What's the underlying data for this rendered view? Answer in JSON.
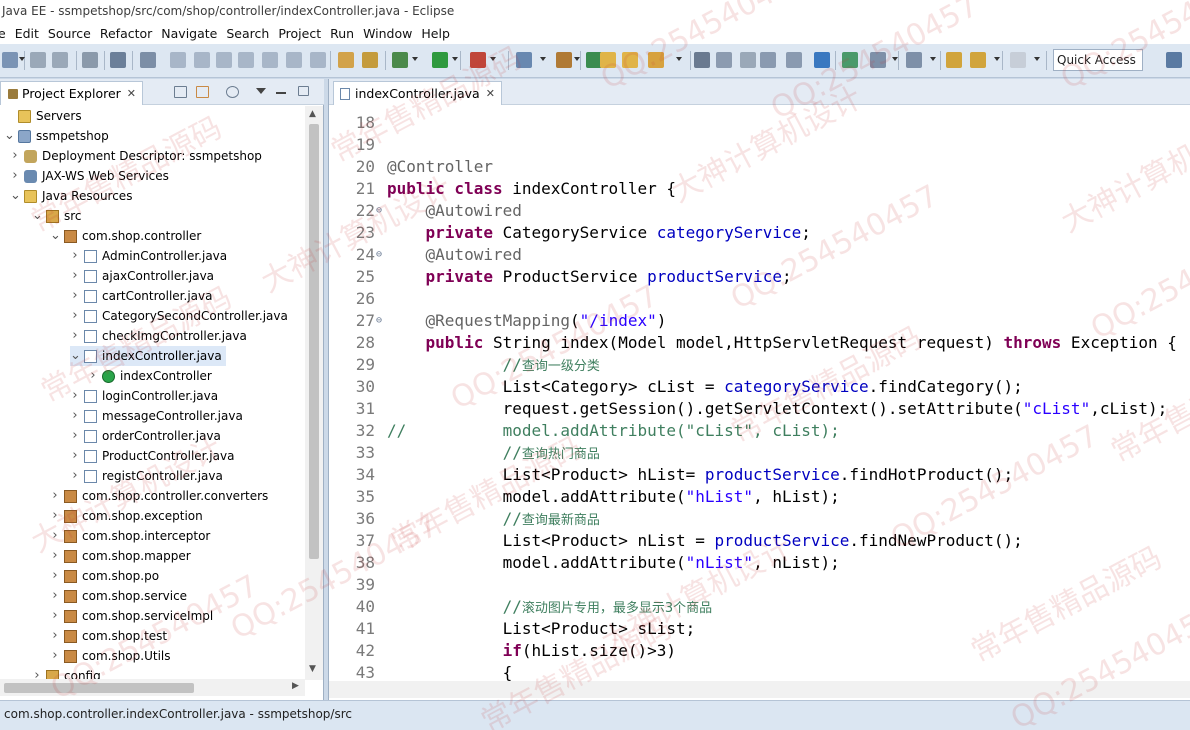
{
  "window": {
    "title": "Java EE - ssmpetshop/src/com/shop/controller/indexController.java - Eclipse"
  },
  "menu": [
    "e",
    "Edit",
    "Source",
    "Refactor",
    "Navigate",
    "Search",
    "Project",
    "Run",
    "Window",
    "Help"
  ],
  "toolbar": {
    "quick_access": "Quick Access"
  },
  "project_explorer": {
    "tab_label": "Project Explorer",
    "tree": [
      {
        "label": "Servers",
        "icon": "folder-icon",
        "arrow": "",
        "indent": 0
      },
      {
        "label": "ssmpetshop",
        "icon": "project-icon",
        "arrow": "open",
        "indent": 0
      },
      {
        "label": "Deployment Descriptor: ssmpetshop",
        "icon": "descriptor-icon",
        "arrow": "closed",
        "indent": 1
      },
      {
        "label": "JAX-WS Web Services",
        "icon": "webservice-icon",
        "arrow": "closed",
        "indent": 1
      },
      {
        "label": "Java Resources",
        "icon": "resources-icon",
        "arrow": "open",
        "indent": 1
      },
      {
        "label": "src",
        "icon": "source-folder-icon",
        "arrow": "open",
        "indent": 2
      },
      {
        "label": "com.shop.controller",
        "icon": "package-icon",
        "arrow": "open",
        "indent": 3
      },
      {
        "label": "AdminController.java",
        "icon": "java-file-icon",
        "arrow": "closed",
        "indent": 4
      },
      {
        "label": "ajaxController.java",
        "icon": "java-file-icon",
        "arrow": "closed",
        "indent": 4
      },
      {
        "label": "cartController.java",
        "icon": "java-file-icon",
        "arrow": "closed",
        "indent": 4
      },
      {
        "label": "CategorySecondController.java",
        "icon": "java-file-icon",
        "arrow": "closed",
        "indent": 4
      },
      {
        "label": "checkImgController.java",
        "icon": "java-file-icon",
        "arrow": "closed",
        "indent": 4
      },
      {
        "label": "indexController.java",
        "icon": "java-file-icon",
        "arrow": "open",
        "indent": 4,
        "selected": true
      },
      {
        "label": "indexController",
        "icon": "class-icon",
        "arrow": "closed",
        "indent": 5
      },
      {
        "label": "loginController.java",
        "icon": "java-file-icon",
        "arrow": "closed",
        "indent": 4
      },
      {
        "label": "messageController.java",
        "icon": "java-file-icon",
        "arrow": "closed",
        "indent": 4
      },
      {
        "label": "orderController.java",
        "icon": "java-file-icon",
        "arrow": "closed",
        "indent": 4
      },
      {
        "label": "ProductController.java",
        "icon": "java-file-icon",
        "arrow": "closed",
        "indent": 4
      },
      {
        "label": "registController.java",
        "icon": "java-file-icon",
        "arrow": "closed",
        "indent": 4
      },
      {
        "label": "com.shop.controller.converters",
        "icon": "package-icon",
        "arrow": "closed",
        "indent": 3
      },
      {
        "label": "com.shop.exception",
        "icon": "package-icon",
        "arrow": "closed",
        "indent": 3
      },
      {
        "label": "com.shop.interceptor",
        "icon": "package-icon",
        "arrow": "closed",
        "indent": 3
      },
      {
        "label": "com.shop.mapper",
        "icon": "package-icon",
        "arrow": "closed",
        "indent": 3
      },
      {
        "label": "com.shop.po",
        "icon": "package-icon",
        "arrow": "closed",
        "indent": 3
      },
      {
        "label": "com.shop.service",
        "icon": "package-icon",
        "arrow": "closed",
        "indent": 3
      },
      {
        "label": "com.shop.serviceImpl",
        "icon": "package-icon",
        "arrow": "closed",
        "indent": 3
      },
      {
        "label": "com.shop.test",
        "icon": "package-icon",
        "arrow": "closed",
        "indent": 3
      },
      {
        "label": "com.shop.Utils",
        "icon": "package-icon",
        "arrow": "closed",
        "indent": 3
      },
      {
        "label": "config",
        "icon": "source-folder-icon",
        "arrow": "closed",
        "indent": 2
      }
    ]
  },
  "editor": {
    "tab_label": "indexController.java",
    "lines": [
      {
        "n": "18",
        "fold": false,
        "html": ""
      },
      {
        "n": "19",
        "fold": false,
        "html": ""
      },
      {
        "n": "20",
        "fold": false,
        "html": "<span class=\"ann\">@Controller</span>"
      },
      {
        "n": "21",
        "fold": false,
        "html": "<span class=\"kw\">public class</span> indexController {"
      },
      {
        "n": "22",
        "fold": true,
        "html": "    <span class=\"ann\">@Autowired</span>"
      },
      {
        "n": "23",
        "fold": false,
        "html": "    <span class=\"kw\">private</span> CategoryService <span class=\"fld\">categoryService</span>;"
      },
      {
        "n": "24",
        "fold": true,
        "html": "    <span class=\"ann\">@Autowired</span>"
      },
      {
        "n": "25",
        "fold": false,
        "html": "    <span class=\"kw\">private</span> ProductService <span class=\"fld\">productService</span>;"
      },
      {
        "n": "26",
        "fold": false,
        "html": ""
      },
      {
        "n": "27",
        "fold": true,
        "html": "    <span class=\"ann\">@RequestMapping</span>(<span class=\"str\">\"/index\"</span>)"
      },
      {
        "n": "28",
        "fold": false,
        "html": "    <span class=\"kw\">public</span> String index(Model model,HttpServletRequest request) <span class=\"kw\">throws</span> Exception {"
      },
      {
        "n": "29",
        "fold": false,
        "html": "            <span class=\"cmt\">//</span><span class=\"cmt-cn\">查询一级分类</span>"
      },
      {
        "n": "30",
        "fold": false,
        "html": "            List&lt;Category&gt; cList = <span class=\"fld\">categoryService</span>.findCategory();"
      },
      {
        "n": "31",
        "fold": false,
        "html": "            request.getSession().getServletContext().setAttribute(<span class=\"str\">\"cList\"</span>,cList);"
      },
      {
        "n": "32",
        "fold": false,
        "html": "<span class=\"cmt\">//          model.addAttribute(\"cList\", cList);</span>"
      },
      {
        "n": "33",
        "fold": false,
        "html": "            <span class=\"cmt\">//</span><span class=\"cmt-cn\">查询热门商品</span>"
      },
      {
        "n": "34",
        "fold": false,
        "html": "            List&lt;Product&gt; hList= <span class=\"fld\">productService</span>.findHotProduct();"
      },
      {
        "n": "35",
        "fold": false,
        "html": "            model.addAttribute(<span class=\"str\">\"hList\"</span>, hList);"
      },
      {
        "n": "36",
        "fold": false,
        "html": "            <span class=\"cmt\">//</span><span class=\"cmt-cn\">查询最新商品</span>"
      },
      {
        "n": "37",
        "fold": false,
        "html": "            List&lt;Product&gt; nList = <span class=\"fld\">productService</span>.findNewProduct();"
      },
      {
        "n": "38",
        "fold": false,
        "html": "            model.addAttribute(<span class=\"str\">\"nList\"</span>, nList);"
      },
      {
        "n": "39",
        "fold": false,
        "html": ""
      },
      {
        "n": "40",
        "fold": false,
        "html": "            <span class=\"cmt\">//</span><span class=\"cmt-cn\">滚动图片专用，最多显示3个商品</span>"
      },
      {
        "n": "41",
        "fold": false,
        "html": "            List&lt;Product&gt; sList;"
      },
      {
        "n": "42",
        "fold": false,
        "html": "            <span class=\"kw\">if</span>(hList.size()&gt;3)"
      },
      {
        "n": "43",
        "fold": false,
        "html": "            {"
      }
    ]
  },
  "statusbar": {
    "text": "com.shop.controller.indexController.java - ssmpetshop/src"
  },
  "watermark": {
    "texts": [
      "QQ:254540457",
      "常年售精品源码",
      "大神计算机设计"
    ]
  }
}
